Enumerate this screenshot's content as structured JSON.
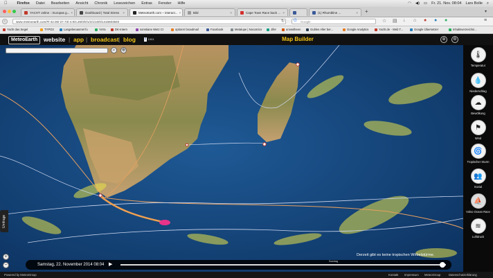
{
  "menubar": {
    "app": "Firefox",
    "items": [
      "Datei",
      "Bearbeiten",
      "Ansicht",
      "Chronik",
      "Lesezeichen",
      "Extras",
      "Fenster",
      "Hilfe"
    ],
    "clock": "Fr. 21. Nov. 08:04",
    "user": "Lars Bolle"
  },
  "tabs": [
    {
      "label": "YACHT online :: Europas g...",
      "color": "#c0392b"
    },
    {
      "label": "Dashboard | Total Stress",
      "color": "#444"
    },
    {
      "label": "MeteoEarth.com – interact...",
      "color": "#222"
    },
    {
      "label": "Bild",
      "color": "#999"
    },
    {
      "label": "Cape Town Race back ...",
      "color": "#d32f2f"
    },
    {
      "label": "",
      "color": "#3b5998"
    },
    {
      "label": "(1) Rhumbline ...",
      "color": "#3b5998"
    }
  ],
  "urlbar": {
    "url": "www.meteoearth.com/#/-42.06/-27.73/-4.9/4.26/0/0/1/2/1/10/0/1416603840",
    "search_placeholder": "Google"
  },
  "bookmarks": [
    {
      "label": "Yacht das Segel",
      "color": "#c0392b"
    },
    {
      "label": "TYPO3",
      "color": "#f39c12"
    },
    {
      "label": "Langebeoanmel fu",
      "color": "#2980b9"
    },
    {
      "label": "YaYa",
      "color": "#27ae60"
    },
    {
      "label": "DK-Intern",
      "color": "#c0392b"
    },
    {
      "label": "sonstiane Wetz Ct",
      "color": "#8e44ad"
    },
    {
      "label": "optionX broadmail",
      "color": "#e67e22"
    },
    {
      "label": "Facebook",
      "color": "#3b5998"
    },
    {
      "label": "Metalupe | Nocosrico",
      "color": "#7f8c8d"
    },
    {
      "label": "Jifer",
      "color": "#16a085"
    },
    {
      "label": "unnwitheen",
      "color": "#d35400"
    },
    {
      "label": "Gubles Aller ber...",
      "color": "#2c3e50"
    },
    {
      "label": "Google Analytics",
      "color": "#e67e22"
    },
    {
      "label": "Yacht.de - Web T...",
      "color": "#c0392b"
    },
    {
      "label": "Google Übersetzer",
      "color": "#2980b9"
    },
    {
      "label": "Inhaltsverzeichni...",
      "color": "#27ae60"
    }
  ],
  "header": {
    "logo": "MeteoEarth",
    "links": [
      "website",
      "app",
      "broadcast",
      "blog"
    ],
    "share_count": "1001",
    "map_title": "Map Builder"
  },
  "map": {
    "umfrage_label": "Umfrage",
    "date_label": "Samstag, 22. November 2014 08:04",
    "track_label": "Sonntag",
    "storm_message": "Derzeit gibt es keine tropischen Wirbelstürme.",
    "view_label": "3D",
    "progress": 0.99
  },
  "sidebar": [
    {
      "label": "Temperatur",
      "icon": "thermometer-icon",
      "glyph": "🌡"
    },
    {
      "label": "Niederschlag",
      "icon": "raindrops-icon",
      "glyph": "💧"
    },
    {
      "label": "Bewölkung",
      "icon": "cloud-icon",
      "glyph": "☁"
    },
    {
      "label": "Wind",
      "icon": "windsock-icon",
      "glyph": "⚑"
    },
    {
      "label": "Tropischer Sturm",
      "icon": "hurricane-icon",
      "glyph": "🌀"
    },
    {
      "label": "Sozial",
      "icon": "people-icon",
      "glyph": "👥"
    },
    {
      "label": "Volvo Ocean Race",
      "icon": "volvo-logo-icon",
      "glyph": "⛵"
    },
    {
      "label": "Luftdruck",
      "icon": "isobar-icon",
      "glyph": "≋"
    }
  ],
  "footer": {
    "brand": "Powered by MeteoGroup",
    "links": [
      "Kontakt",
      "Impressum",
      "MeteoGroup",
      "Datenschutzerklärung"
    ]
  },
  "colors": {
    "accent": "#f5c518",
    "ocean": "#12407a",
    "route": "#e8a060",
    "wind": "#e8e24a"
  }
}
